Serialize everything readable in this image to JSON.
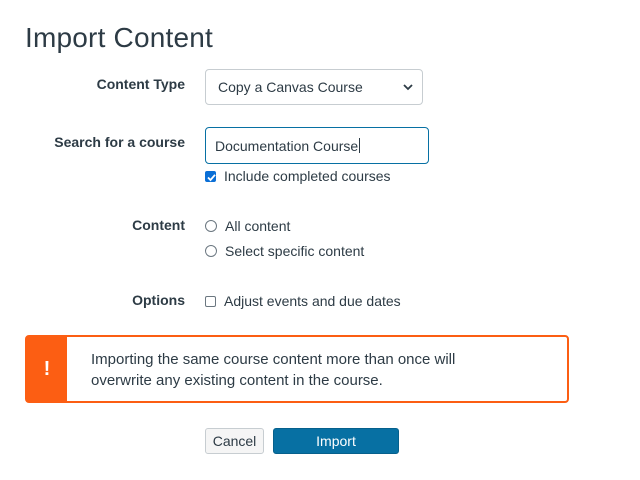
{
  "page": {
    "title": "Import Content"
  },
  "form": {
    "content_type": {
      "label": "Content Type",
      "selected": "Copy a Canvas Course"
    },
    "search": {
      "label": "Search for a course",
      "value": "Documentation Course",
      "include_completed_label": "Include completed courses",
      "include_completed_checked": true
    },
    "content": {
      "label": "Content",
      "options": [
        "All content",
        "Select specific content"
      ]
    },
    "options": {
      "label": "Options",
      "adjust_dates_label": "Adjust events and due dates",
      "adjust_dates_checked": false
    }
  },
  "alert": {
    "icon": "exclamation-icon",
    "symbol": "!",
    "line1": "Importing the same course content more than once will",
    "line2": "overwrite any existing content in the course.",
    "color": "#fc5e13"
  },
  "buttons": {
    "cancel": "Cancel",
    "import": "Import"
  },
  "colors": {
    "primary": "#0770a3",
    "warning": "#fc5e13",
    "checkbox": "#0b6fd6"
  }
}
